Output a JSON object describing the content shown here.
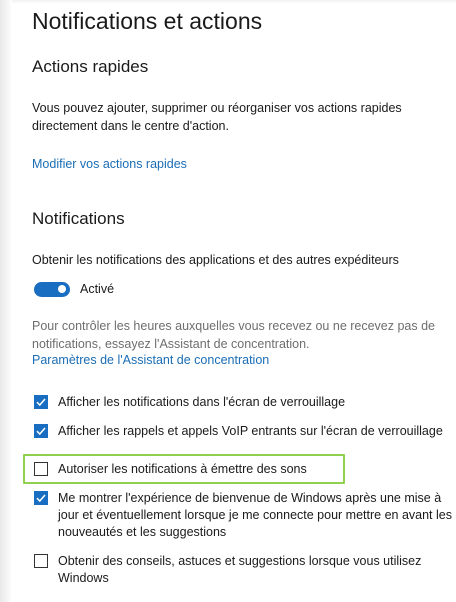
{
  "title": "Notifications et actions",
  "quick_actions": {
    "heading": "Actions rapides",
    "description": "Vous pouvez ajouter, supprimer ou réorganiser vos actions rapides directement dans le centre d'action.",
    "link": "Modifier vos actions rapides"
  },
  "notifications": {
    "heading": "Notifications",
    "toggle_prompt": "Obtenir les notifications des applications et des autres expéditeurs",
    "toggle_state": "Activé",
    "toggle_on": true,
    "focus_info": "Pour contrôler les heures auxquelles vous recevez ou ne recevez pas de notifications, essayez l'Assistant de concentration.",
    "focus_link": "Paramètres de l'Assistant de concentration",
    "options": [
      {
        "label": "Afficher les notifications dans l'écran de verrouillage",
        "checked": true
      },
      {
        "label": "Afficher les rappels et appels VoIP entrants sur l'écran de verrouillage",
        "checked": true
      },
      {
        "label": "Autoriser les notifications à émettre des sons",
        "checked": false
      },
      {
        "label": "Me montrer l'expérience de bienvenue de Windows après une mise à jour et éventuellement lorsque je me connecte pour mettre en avant les nouveautés et les suggestions",
        "checked": true
      },
      {
        "label": "Obtenir des conseils, astuces et suggestions lorsque vous utilisez Windows",
        "checked": false
      }
    ]
  },
  "colors": {
    "accent": "#1a6ec1",
    "link": "#1a6db5",
    "highlight": "#8fd14f"
  }
}
